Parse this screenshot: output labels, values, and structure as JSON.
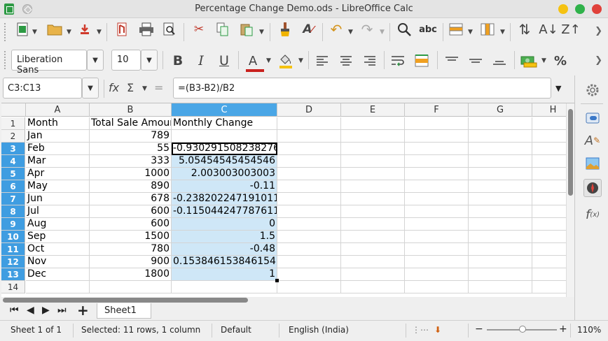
{
  "window": {
    "title": "Percentage Change Demo.ods - LibreOffice Calc"
  },
  "toolbar2": {
    "font_name": "Liberation Sans",
    "font_size": "10",
    "percent_symbol": "%"
  },
  "formula_bar": {
    "name_box": "C3:C13",
    "formula": "=(B3-B2)/B2",
    "fx": "fx",
    "sigma": "Σ",
    "equals": "="
  },
  "columns": [
    "A",
    "B",
    "C",
    "D",
    "E",
    "F",
    "G",
    "H"
  ],
  "rows": [
    {
      "n": "1",
      "a": "Month",
      "b": "Total Sale Amount",
      "c": "Monthly Change"
    },
    {
      "n": "2",
      "a": "Jan",
      "b": "789",
      "c": ""
    },
    {
      "n": "3",
      "a": "Feb",
      "b": "55",
      "c": "-0.930291508238276"
    },
    {
      "n": "4",
      "a": "Mar",
      "b": "333",
      "c": "5.05454545454546"
    },
    {
      "n": "5",
      "a": "Apr",
      "b": "1000",
      "c": "2.003003003003"
    },
    {
      "n": "6",
      "a": "May",
      "b": "890",
      "c": "-0.11"
    },
    {
      "n": "7",
      "a": "Jun",
      "b": "678",
      "c": "-0.238202247191011"
    },
    {
      "n": "8",
      "a": "Jul",
      "b": "600",
      "c": "-0.115044247787611"
    },
    {
      "n": "9",
      "a": "Aug",
      "b": "600",
      "c": "0"
    },
    {
      "n": "10",
      "a": "Sep",
      "b": "1500",
      "c": "1.5"
    },
    {
      "n": "11",
      "a": "Oct",
      "b": "780",
      "c": "-0.48"
    },
    {
      "n": "12",
      "a": "Nov",
      "b": "900",
      "c": "0.153846153846154"
    },
    {
      "n": "13",
      "a": "Dec",
      "b": "1800",
      "c": "1"
    },
    {
      "n": "14",
      "a": "",
      "b": "",
      "c": ""
    }
  ],
  "sheet_tabs": [
    "Sheet1"
  ],
  "statusbar": {
    "sheet": "Sheet 1 of 1",
    "selection": "Selected: 11 rows, 1 column",
    "style": "Default",
    "language": "English (India)",
    "zoom": "110%"
  },
  "colors": {
    "selection_fill": "#cfe7f7",
    "header_selected": "#4aa6e6",
    "accent_green": "#2d9a44"
  }
}
